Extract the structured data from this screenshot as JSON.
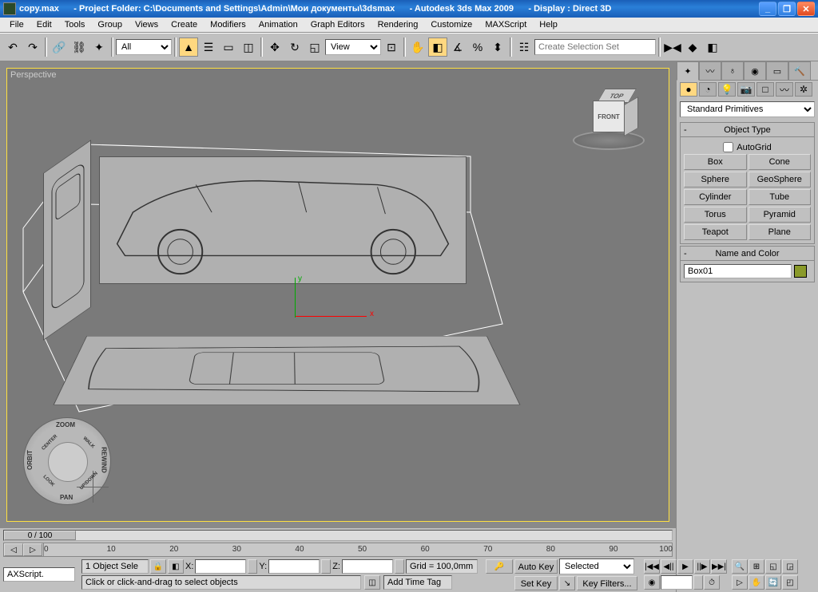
{
  "title": {
    "filename": "copy.max",
    "project_folder_label": "- Project Folder: C:\\Documents and Settings\\Admin\\Мои документы\\3dsmax",
    "app_name": "- Autodesk 3ds Max  2009",
    "display_mode": "- Display : Direct 3D"
  },
  "menu": {
    "file": "File",
    "edit": "Edit",
    "tools": "Tools",
    "group": "Group",
    "views": "Views",
    "create": "Create",
    "modifiers": "Modifiers",
    "animation": "Animation",
    "graph_editors": "Graph Editors",
    "rendering": "Rendering",
    "customize": "Customize",
    "maxscript": "MAXScript",
    "help": "Help"
  },
  "toolbar": {
    "filter_dropdown": "All",
    "view_dropdown": "View",
    "selection_set_placeholder": "Create Selection Set"
  },
  "viewport": {
    "label": "Perspective",
    "viewcube": {
      "top": "TOP",
      "front": "FRONT"
    }
  },
  "navwheel": {
    "zoom": "ZOOM",
    "orbit": "ORBIT",
    "pan": "PAN",
    "rewind": "REWIND",
    "center": "CENTER",
    "walk": "WALK",
    "look": "LOOK",
    "updown": "UP/DOWN"
  },
  "cmd_panel": {
    "category_dropdown": "Standard Primitives",
    "rollout_object_type": "Object Type",
    "autogrid_label": "AutoGrid",
    "primitives": {
      "box": "Box",
      "cone": "Cone",
      "sphere": "Sphere",
      "geosphere": "GeoSphere",
      "cylinder": "Cylinder",
      "tube": "Tube",
      "torus": "Torus",
      "pyramid": "Pyramid",
      "teapot": "Teapot",
      "plane": "Plane"
    },
    "rollout_name_color": "Name and Color",
    "object_name": "Box01",
    "object_color": "#8a9a2a"
  },
  "timeline": {
    "frame_display": "0 / 100",
    "ticks": [
      "0",
      "10",
      "20",
      "30",
      "40",
      "50",
      "60",
      "70",
      "80",
      "90",
      "100"
    ]
  },
  "status": {
    "selection_info": "1 Object Sele",
    "x_label": "X:",
    "y_label": "Y:",
    "z_label": "Z:",
    "grid_label": "Grid = 100,0mm",
    "prompt": "Click or click-and-drag to select objects",
    "add_time_tag": "Add Time Tag",
    "auto_key": "Auto Key",
    "set_key": "Set Key",
    "selected_dropdown": "Selected",
    "key_filters": "Key Filters...",
    "axscript": "AXScript."
  }
}
